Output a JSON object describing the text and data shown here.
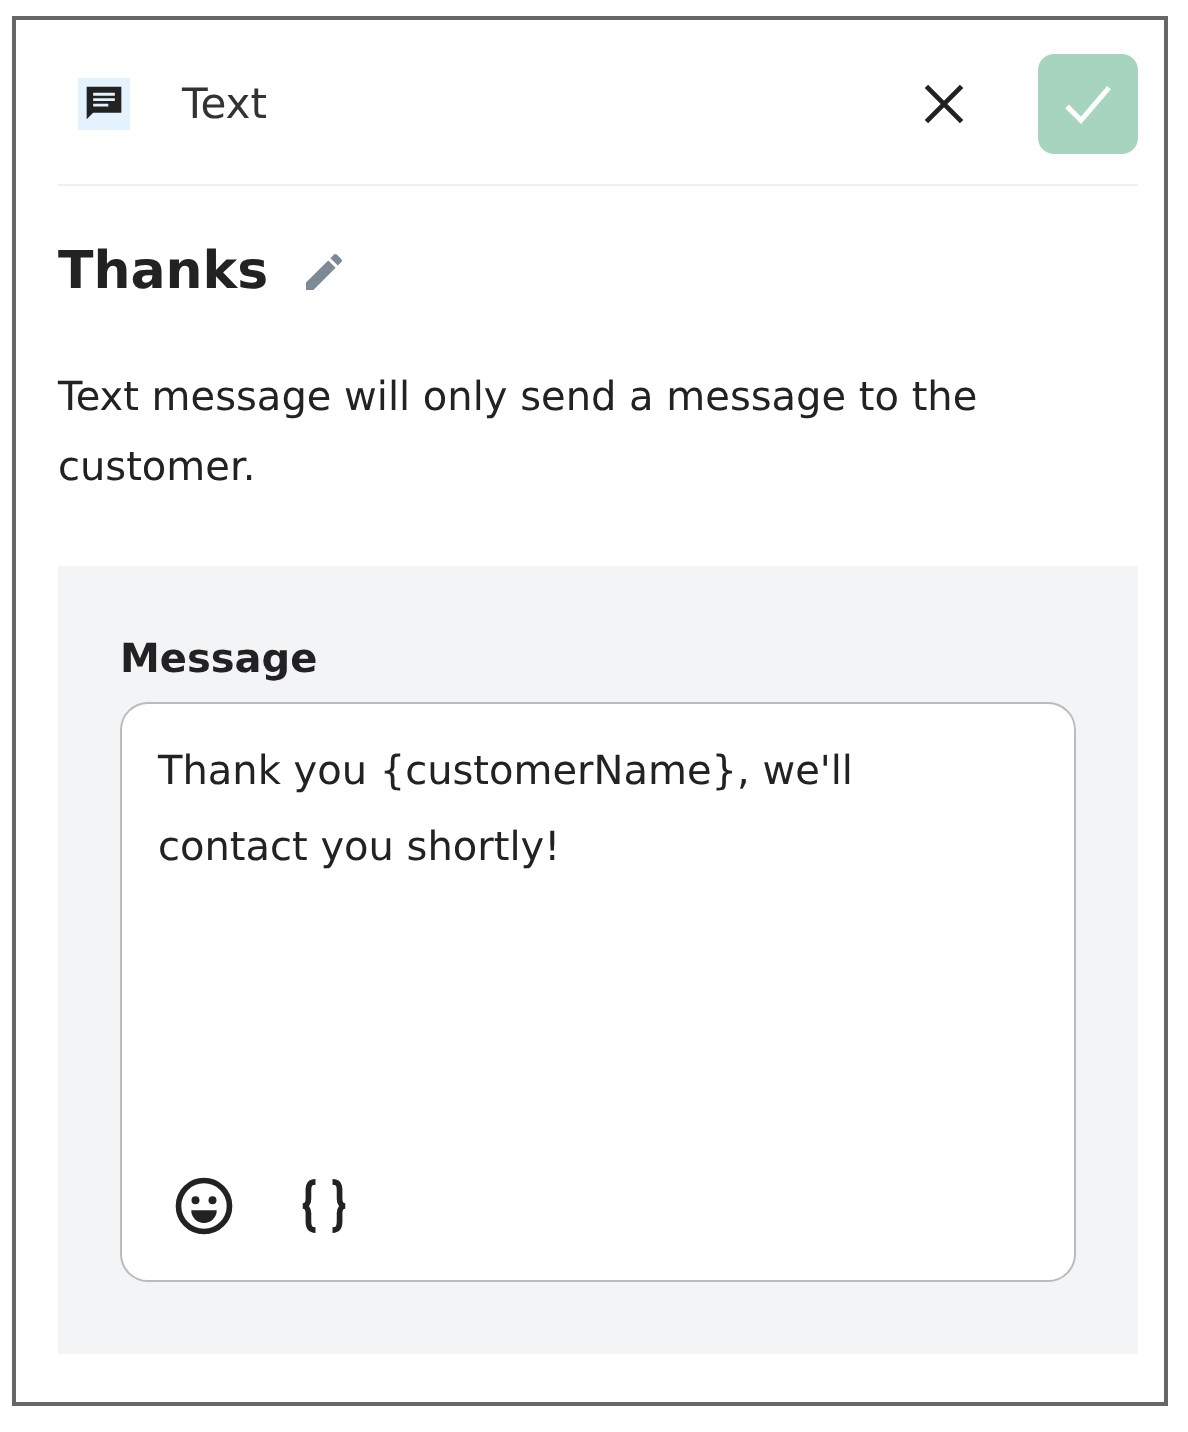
{
  "header": {
    "type_label": "Text",
    "confirm_disabled": true
  },
  "title": "Thanks",
  "description": "Text message will only send a message to the customer.",
  "message": {
    "label": "Message",
    "value": "Thank you {customerName}, we'll contact you shortly!"
  }
}
